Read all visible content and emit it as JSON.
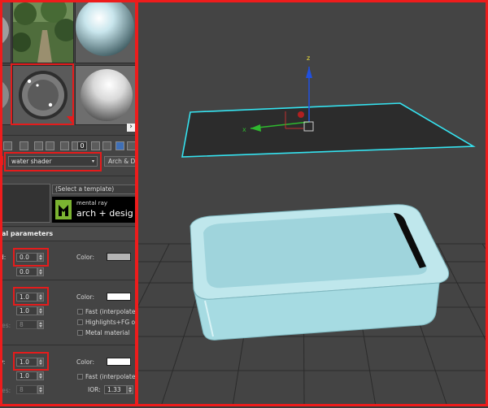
{
  "material_editor": {
    "slots": [
      {
        "name": "outdoor-environment-sample"
      },
      {
        "name": "light-blue-sphere-sample"
      },
      {
        "name": "water-shader-sample",
        "selected": true
      },
      {
        "name": "white-sphere-sample"
      }
    ],
    "expand_arrow": "›",
    "toolbar": {
      "icons": [
        "put-to-scene-icon",
        "assign-material-icon",
        "reset-icon",
        "copy-material-icon",
        "unique-icon",
        "put-to-library-icon",
        "material-id-channel-icon",
        "show-in-viewport-icon",
        "show-end-result-icon",
        "go-to-parent-icon"
      ],
      "material_id": "0"
    },
    "material_name": "water shader",
    "material_type": "Arch & D",
    "template_placeholder": "(Select a template)",
    "brand": {
      "line1": "mental ray",
      "line2": "arch + desig"
    },
    "section_title": "al parameters",
    "rows": [
      {
        "label": "d:",
        "value": "0.0",
        "sub_value": "0.0",
        "color_label": "Color:",
        "color": "#b4b4b4"
      },
      {
        "label": "",
        "value": "1.0",
        "sub_value": "1.0",
        "sub_value2": "8",
        "dim_label": "les:",
        "color_label": "Color:",
        "color": "#ffffff",
        "options": [
          {
            "label": "Fast (interpolate",
            "checked": false
          },
          {
            "label": "Highlights+FG on",
            "checked": false
          },
          {
            "label": "Metal material",
            "checked": false
          }
        ]
      },
      {
        "label": "y:",
        "value": "1.0",
        "sub_value": "1.0",
        "sub_value2": "8",
        "dim_label": "les:",
        "color_label": "Color:",
        "color": "#ffffff",
        "options": [
          {
            "label": "Fast (interpolate",
            "checked": false
          }
        ],
        "ior_label": "IOR:",
        "ior_value": "1.33"
      }
    ]
  },
  "viewport": {
    "gizmo": {
      "axis_z": "z",
      "axis_x": "x"
    },
    "colors": {
      "background": "#444444",
      "grid": "#2b2b2b",
      "plane": "#2c2c2c",
      "plane_outline": "#35e3f0",
      "object": "#a9dfe6",
      "highlight": "#e41c1c"
    }
  }
}
